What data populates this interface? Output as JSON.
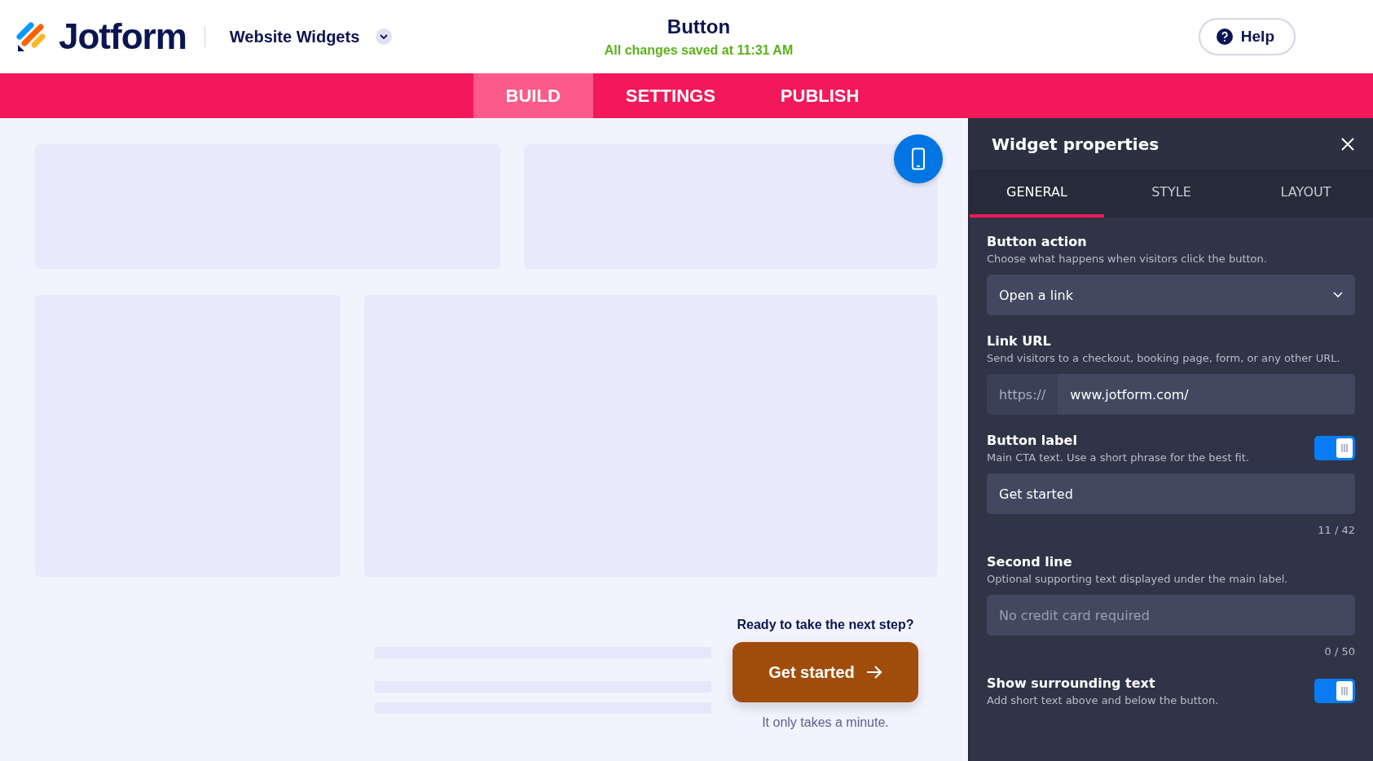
{
  "header": {
    "brand": "Jotform",
    "workspace": "Website Widgets",
    "title": "Button",
    "save_status": "All changes saved at 11:31 AM",
    "help": "Help"
  },
  "nav_tabs": [
    {
      "label": "BUILD",
      "selected": true
    },
    {
      "label": "SETTINGS",
      "selected": false
    },
    {
      "label": "PUBLISH",
      "selected": false
    }
  ],
  "preview": {
    "above_text": "Ready to take the next step?",
    "button_label": "Get started",
    "below_text": "It only takes a minute."
  },
  "panel": {
    "title": "Widget properties",
    "tabs": [
      {
        "label": "GENERAL",
        "selected": true
      },
      {
        "label": "STYLE",
        "selected": false
      },
      {
        "label": "LAYOUT",
        "selected": false
      }
    ],
    "sections": [
      {
        "kind": "select",
        "label": "Button action",
        "hint": "Choose what happens when visitors click the button.",
        "value": "Open a link"
      },
      {
        "kind": "url",
        "label": "Link URL",
        "hint": "Send visitors to a checkout, booking page, form, or any other URL.",
        "prefix": "https://",
        "value": "www.jotform.com/"
      },
      {
        "kind": "text",
        "label": "Button label",
        "hint": "Main CTA text. Use a short phrase for the best fit.",
        "on": true,
        "value": "Get started",
        "count": "11 / 42"
      },
      {
        "kind": "text",
        "label": "Second line",
        "hint": "Optional supporting text displayed under the main label.",
        "placeholder": "No credit card required",
        "count": "0 / 50"
      },
      {
        "kind": "toggle",
        "label": "Show surrounding text",
        "hint": "Add short text above and below the button.",
        "on": true
      }
    ]
  }
}
